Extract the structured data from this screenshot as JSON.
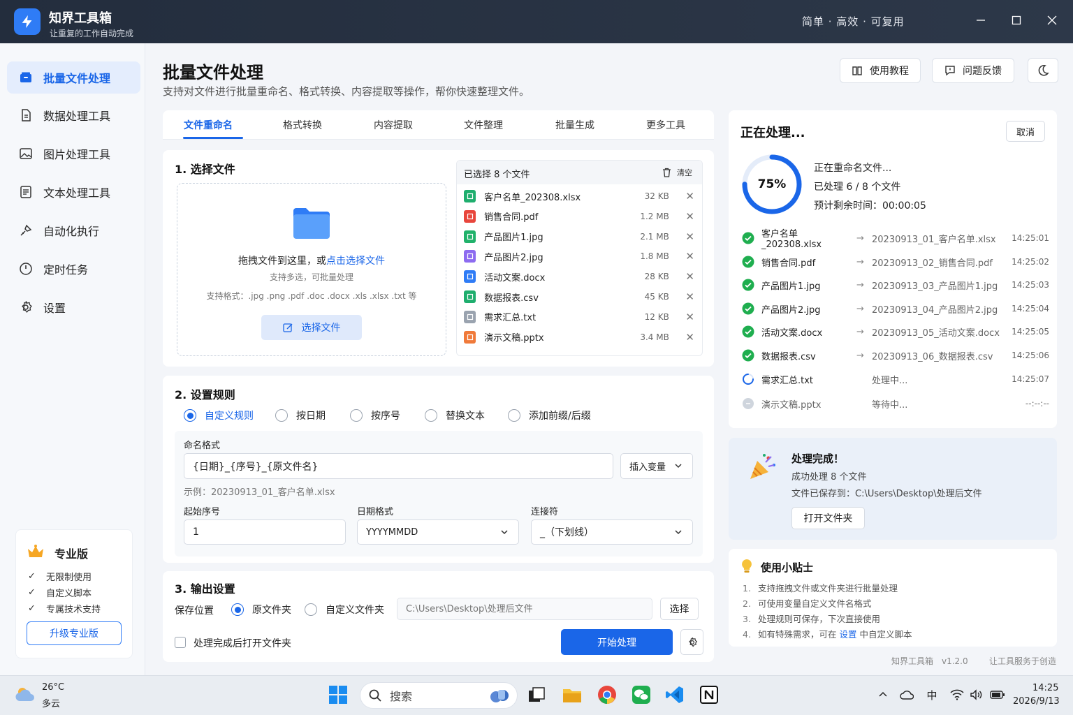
{
  "app": {
    "name": "知界工具箱",
    "subtitle": "让重复的工作自动完成",
    "slogan": "简单 · 高效 · 可复用"
  },
  "sidebar": {
    "items": [
      {
        "label": "批量文件处理",
        "icon": "batch-file-icon",
        "active": true
      },
      {
        "label": "数据处理工具",
        "icon": "document-icon"
      },
      {
        "label": "图片处理工具",
        "icon": "image-icon"
      },
      {
        "label": "文本处理工具",
        "icon": "text-doc-icon"
      },
      {
        "label": "自动化执行",
        "icon": "automation-icon"
      },
      {
        "label": "定时任务",
        "icon": "clock-icon"
      },
      {
        "label": "设置",
        "icon": "gear-icon"
      }
    ],
    "pro": {
      "title": "专业版",
      "features": [
        "无限制使用",
        "自定义脚本",
        "专属技术支持"
      ],
      "upgrade_label": "升级专业版"
    }
  },
  "header": {
    "title": "批量文件处理",
    "description": "支持对文件进行批量重命名、格式转换、内容提取等操作，帮你快速整理文件。",
    "tutorial_label": "使用教程",
    "feedback_label": "问题反馈"
  },
  "tabs": [
    "文件重命名",
    "格式转换",
    "内容提取",
    "文件整理",
    "批量生成",
    "更多工具"
  ],
  "select_files": {
    "title": "1. 选择文件",
    "drop_text": "拖拽文件到这里，或",
    "drop_link": "点击选择文件",
    "drop_sub": "支持多选，可批量处理",
    "formats": "支持格式：.jpg .png .pdf .doc .docx .xls .xlsx .txt 等",
    "choose_label": "选择文件",
    "list_title": "已选择 8 个文件",
    "clear_label": "清空",
    "files": [
      {
        "name": "客户名单_202308.xlsx",
        "size": "32 KB",
        "type": "xlsx",
        "color": "#1fae6e"
      },
      {
        "name": "销售合同.pdf",
        "size": "1.2 MB",
        "type": "pdf",
        "color": "#e8463c"
      },
      {
        "name": "产品图片1.jpg",
        "size": "2.1 MB",
        "type": "jpg",
        "color": "#21b26b"
      },
      {
        "name": "产品图片2.jpg",
        "size": "1.8 MB",
        "type": "jpg",
        "color": "#8d6cf0"
      },
      {
        "name": "活动文案.docx",
        "size": "28 KB",
        "type": "docx",
        "color": "#2f7cf6"
      },
      {
        "name": "数据报表.csv",
        "size": "45 KB",
        "type": "csv",
        "color": "#1fae6e"
      },
      {
        "name": "需求汇总.txt",
        "size": "12 KB",
        "type": "txt",
        "color": "#9aa3af"
      },
      {
        "name": "演示文稿.pptx",
        "size": "3.4 MB",
        "type": "pptx",
        "color": "#f07a3a"
      }
    ]
  },
  "rules": {
    "title": "2. 设置规则",
    "options": [
      "自定义规则",
      "按日期",
      "按序号",
      "替换文本",
      "添加前缀/后缀"
    ],
    "selected": 0,
    "format_label": "命名格式",
    "format_value": "{日期}_{序号}_{原文件名}",
    "insert_var_label": "插入变量",
    "example": "示例：20230913_01_客户名单.xlsx",
    "start_label": "起始序号",
    "start_value": "1",
    "date_label": "日期格式",
    "date_value": "YYYYMMDD",
    "sep_label": "连接符",
    "sep_value": "_（下划线）"
  },
  "output": {
    "title": "3. 输出设置",
    "location_label": "保存位置",
    "opt_original": "原文件夹",
    "opt_custom": "自定义文件夹",
    "path_placeholder": "C:\\Users\\Desktop\\处理后文件",
    "choose_label": "选择",
    "open_after_label": "处理完成后打开文件夹",
    "start_label": "开始处理"
  },
  "processing": {
    "title": "正在处理...",
    "cancel_label": "取消",
    "percent_label": "75%",
    "progress": 0.75,
    "line1": "正在重命名文件...",
    "line2": "已处理 6 / 8 个文件",
    "line3": "预计剩余时间：00:00:05",
    "rows": [
      {
        "src": "客户名单_202308.xlsx",
        "dst": "20230913_01_客户名单.xlsx",
        "time": "14:25:01",
        "status": "done"
      },
      {
        "src": "销售合同.pdf",
        "dst": "20230913_02_销售合同.pdf",
        "time": "14:25:02",
        "status": "done"
      },
      {
        "src": "产品图片1.jpg",
        "dst": "20230913_03_产品图片1.jpg",
        "time": "14:25:03",
        "status": "done"
      },
      {
        "src": "产品图片2.jpg",
        "dst": "20230913_04_产品图片2.jpg",
        "time": "14:25:04",
        "status": "done"
      },
      {
        "src": "活动文案.docx",
        "dst": "20230913_05_活动文案.docx",
        "time": "14:25:05",
        "status": "done"
      },
      {
        "src": "数据报表.csv",
        "dst": "20230913_06_数据报表.csv",
        "time": "14:25:06",
        "status": "done"
      },
      {
        "src": "需求汇总.txt",
        "dst": "处理中...",
        "time": "14:25:07",
        "status": "running"
      },
      {
        "src": "演示文稿.pptx",
        "dst": "等待中...",
        "time": "--:--:--",
        "status": "waiting"
      }
    ]
  },
  "done": {
    "title": "处理完成！",
    "count": "成功处理 8 个文件",
    "path": "文件已保存到：C:\\Users\\Desktop\\处理后文件",
    "open_label": "打开文件夹"
  },
  "tips": {
    "title": "使用小贴士",
    "items": [
      {
        "n": "1.",
        "text": "支持拖拽文件或文件夹进行批量处理"
      },
      {
        "n": "2.",
        "text": "可使用变量自定义文件名格式"
      },
      {
        "n": "3.",
        "text": "处理规则可保存，下次直接使用"
      },
      {
        "n": "4.",
        "pre": "如有特殊需求，可在 ",
        "link": "设置",
        "post": " 中自定义脚本"
      }
    ]
  },
  "footer": {
    "version": "知界工具箱　v1.2.0",
    "slogan": "让工具服务于创造"
  },
  "taskbar": {
    "temp": "26°C",
    "weather": "多云",
    "search_placeholder": "搜索",
    "tray_lang": "中",
    "time": "14:25",
    "date": "2026/9/13"
  },
  "colors": {
    "accent": "#1a66e8",
    "success": "#1fae4f",
    "titlebar": "#252f3f"
  }
}
